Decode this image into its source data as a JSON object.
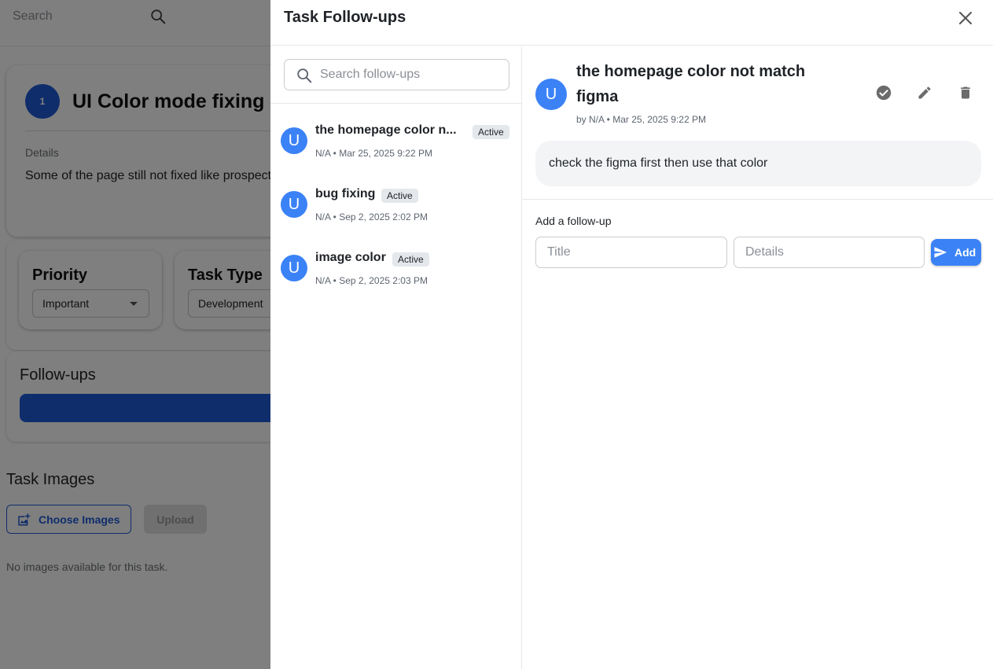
{
  "background": {
    "search_placeholder": "Search",
    "task": {
      "number": "1",
      "title": "UI Color mode fixing",
      "details_label": "Details",
      "details_text": "Some of the page still not fixed like prospect"
    },
    "priority": {
      "label": "Priority",
      "value": "Important"
    },
    "task_type": {
      "label": "Task Type",
      "value": "Development"
    },
    "followups_title": "Follow-ups",
    "images": {
      "title": "Task Images",
      "choose_label": "Choose Images",
      "upload_label": "Upload",
      "empty_text": "No images available for this task."
    }
  },
  "drawer": {
    "title": "Task Follow-ups",
    "search_placeholder": "Search follow-ups",
    "followups": [
      {
        "avatar": "U",
        "title": "the homepage color n...",
        "status": "Active",
        "meta": "N/A • Mar 25, 2025 9:22 PM"
      },
      {
        "avatar": "U",
        "title": "bug fixing",
        "status": "Active",
        "meta": "N/A • Sep 2, 2025 2:02 PM"
      },
      {
        "avatar": "U",
        "title": "image color",
        "status": "Active",
        "meta": "N/A • Sep 2, 2025 2:03 PM"
      }
    ],
    "selected": {
      "avatar": "U",
      "title": "the homepage color not match figma",
      "meta": "by N/A • Mar 25, 2025 9:22 PM",
      "body": "check the figma first then use that color"
    },
    "add_form": {
      "label": "Add a follow-up",
      "title_placeholder": "Title",
      "details_placeholder": "Details",
      "add_label": "Add"
    }
  },
  "colors": {
    "primary": "#1e5ad7",
    "avatar": "#3b82f6",
    "badge_bg": "#e4e7eb",
    "overlay": "rgba(0,0,0,0.5)"
  }
}
